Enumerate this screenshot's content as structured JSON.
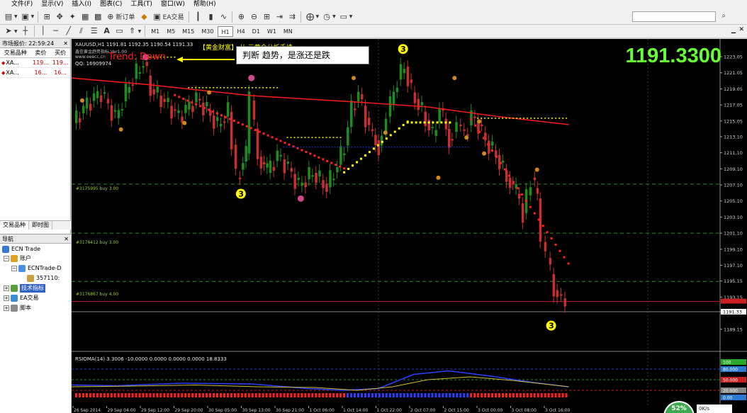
{
  "menu": [
    "文件(F)",
    "显示(V)",
    "插入(I)",
    "图表(C)",
    "工具(T)",
    "窗口(W)",
    "帮助(H)"
  ],
  "toolbar": {
    "new_order": "新订单",
    "ea_trading": "EA交易",
    "search_placeholder": ""
  },
  "timeframes": [
    "M1",
    "M5",
    "M15",
    "M30",
    "H1",
    "H4",
    "D1",
    "W1",
    "MN"
  ],
  "active_timeframe": "H1",
  "market_watch": {
    "title": "市场报价: 22:59:24",
    "columns": [
      "交易品种",
      "卖价",
      "买价"
    ],
    "rows": [
      {
        "symbol": "XA...",
        "bid": "119...",
        "ask": "119..."
      },
      {
        "symbol": "XA...",
        "bid": "16...",
        "ask": "16..."
      }
    ],
    "tabs": [
      "交易品种",
      "即时图"
    ]
  },
  "navigator": {
    "title": "导航",
    "items": [
      "ECN Trade",
      "账户",
      "ECNTrade-D",
      "357110:",
      "技术指标",
      "EA交易",
      "脚本"
    ]
  },
  "chart": {
    "symbol_info": "XAUUSD,H1  1191.81  1192.35  1190.54  1191.33",
    "indicator_name": "鑫信黄金趋势指标 Ver1.00",
    "indicator_url": "www.eeecc.cn",
    "qq": "QQ: 16909974",
    "ad_banner": "【黄金财富】 从 元黄金分析手续",
    "trend_text": "Trend: Down",
    "callout": "判断 趋势，是涨还是跌",
    "big_price": "1191.3300",
    "order_lines": [
      "#3175995 buy 3.00",
      "#3176412 buy 3.00",
      "#3176867 buy 4.00"
    ],
    "rsi_label": "RSIOMA(14) 3.3006 -10.0000 0.0000 0.0000 0.0000 18.8333",
    "wave_labels": [
      "3",
      "3",
      "3"
    ],
    "current_price_tag": "1191.33",
    "y_ticks": [
      "1223.05",
      "1221.05",
      "1219.05",
      "1217.05",
      "1215.05",
      "1213.10",
      "1211.10",
      "1209.10",
      "1207.10",
      "1205.10",
      "1203.10",
      "1201.10",
      "1199.10",
      "1197.10",
      "1195.15",
      "1193.15",
      "1191.33",
      "1189.15"
    ],
    "rsi_ticks": [
      "100",
      "80.000",
      "50.000",
      "20.000",
      "0.00"
    ],
    "x_ticks": [
      "26 Sep 2014",
      "29 Sep 04:00",
      "29 Sep 12:00",
      "29 Sep 20:00",
      "30 Sep 05:00",
      "30 Sep 13:00",
      "30 Sep 21:00",
      "1 Oct 06:00",
      "1 Oct 14:00",
      "1 Oct 22:00",
      "2 Oct 07:00",
      "2 Oct 15:00",
      "3 Oct 00:00",
      "3 Oct 08:00",
      "3 Oct 16:00"
    ]
  },
  "status": {
    "percent": "52%",
    "speed": "0K/s"
  },
  "colors": {
    "bear": "#c83030",
    "bull": "#1e8c1e",
    "ma": "#ff1a1a",
    "signal_yellow": "#ffff00",
    "price_green": "#66ff33"
  }
}
